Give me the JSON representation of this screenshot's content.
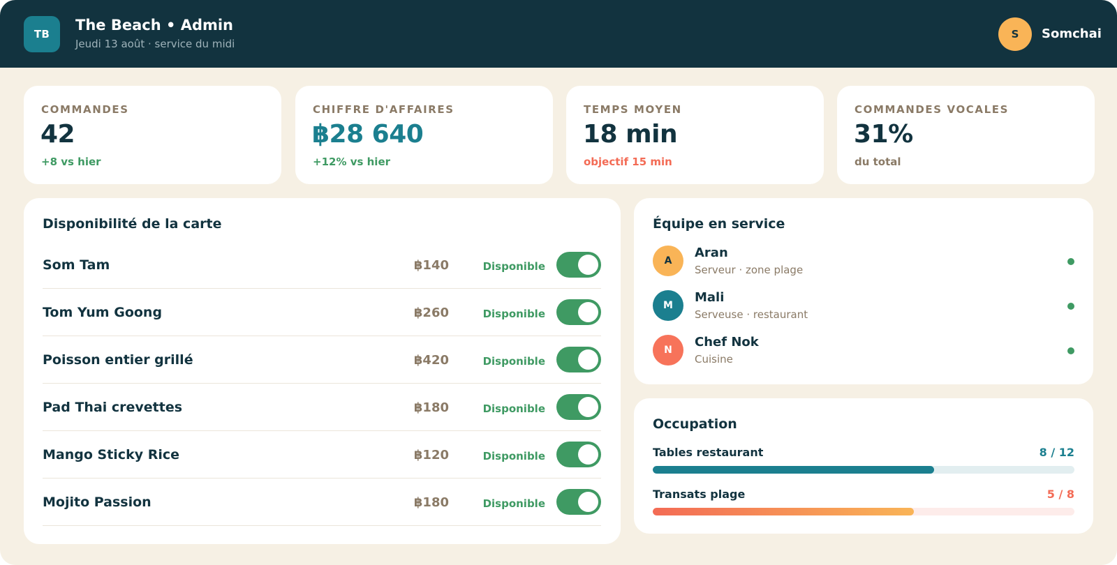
{
  "header": {
    "logo_initials": "TB",
    "title": "The Beach • Admin",
    "subtitle": "Jeudi 13 août · service du midi",
    "user_initial": "S",
    "user_name": "Somchai"
  },
  "kpis": [
    {
      "label": "COMMANDES",
      "value": "42",
      "note": "+8 vs hier"
    },
    {
      "label": "CHIFFRE D'AFFAIRES",
      "value": "฿28 640",
      "note": "+12% vs hier"
    },
    {
      "label": "TEMPS MOYEN",
      "value": "18 min",
      "note": "objectif 15 min"
    },
    {
      "label": "COMMANDES VOCALES",
      "value": "31%",
      "note": "du total"
    }
  ],
  "menu": {
    "title": "Disponibilité de la carte",
    "items": [
      {
        "name": "Som Tam",
        "price": "฿140",
        "status": "Disponible",
        "available": true
      },
      {
        "name": "Tom Yum Goong",
        "price": "฿260",
        "status": "Disponible",
        "available": true
      },
      {
        "name": "Poisson entier grillé",
        "price": "฿420",
        "status": "Disponible",
        "available": true
      },
      {
        "name": "Pad Thai crevettes",
        "price": "฿180",
        "status": "Disponible",
        "available": true
      },
      {
        "name": "Mango Sticky Rice",
        "price": "฿120",
        "status": "Disponible",
        "available": true
      },
      {
        "name": "Mojito Passion",
        "price": "฿180",
        "status": "Disponible",
        "available": true
      }
    ]
  },
  "team": {
    "title": "Équipe en service",
    "members": [
      {
        "initial": "A",
        "name": "Aran",
        "role": "Serveur · zone plage",
        "avatar_color": "#f9b457",
        "text_color": "#12333f"
      },
      {
        "initial": "M",
        "name": "Mali",
        "role": "Serveuse · restaurant",
        "avatar_color": "#1b7f8f",
        "text_color": "#ffffff"
      },
      {
        "initial": "N",
        "name": "Chef Nok",
        "role": "Cuisine",
        "avatar_color": "#f7735a",
        "text_color": "#ffffff"
      }
    ],
    "online_color": "#3f9a63"
  },
  "occupation": {
    "title": "Occupation",
    "rows": [
      {
        "label": "Tables restaurant",
        "count": "8 / 12",
        "fraction": 0.667,
        "color": "#1b7f8f",
        "track_color": "#e2eef0"
      },
      {
        "label": "Transats plage",
        "count": "5 / 8",
        "fraction": 0.62,
        "color": "#f36b55",
        "color_end": "#f9b457",
        "track_color": "#fdecea"
      }
    ]
  },
  "colors": {
    "header_bg": "#12333f",
    "page_bg": "#f6f0e4",
    "accent_teal": "#1b7f8f",
    "positive": "#3f9a63",
    "warning": "#f36b55",
    "muted": "#8a7a66"
  }
}
